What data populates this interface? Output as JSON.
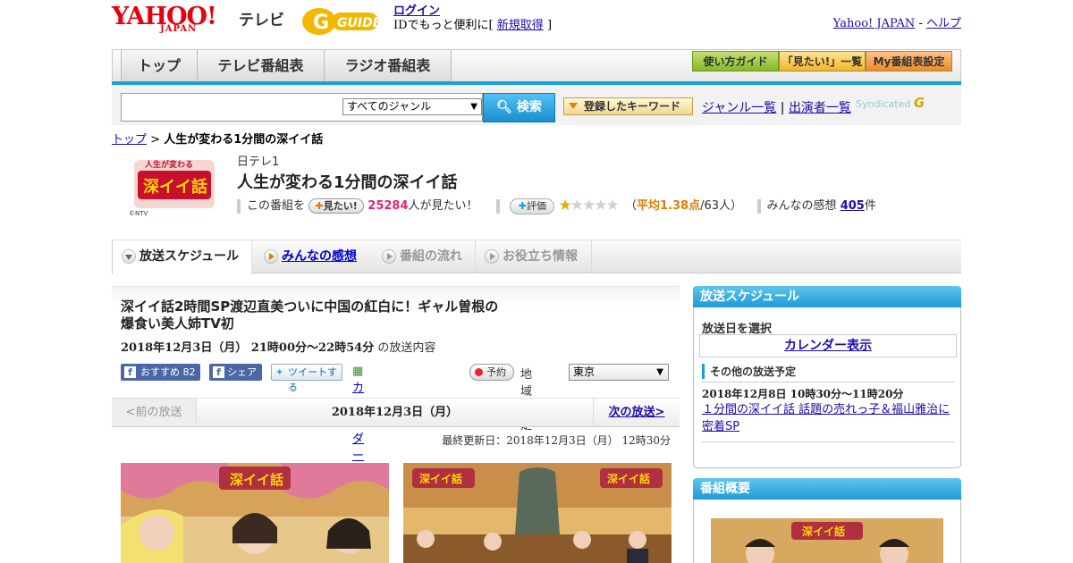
{
  "header": {
    "yahoo_logo": "YAHOO!",
    "yahoo_sub": "JAPAN",
    "tv_label": "テレビ",
    "gguide_logo": "G GUIDE",
    "login_link": "ログイン",
    "login_prefix": "IDでもっと便利に[",
    "register_link": "新規取得",
    "login_suffix": "]",
    "yahoo_japan_link": "Yahoo! JAPAN",
    "separator": "-",
    "help_link": "ヘルプ"
  },
  "nav": {
    "tabs": [
      "トップ",
      "テレビ番組表",
      "ラジオ番組表"
    ],
    "guide_btn": "使い方ガイド",
    "mitai_list_btn": "「見たい!」一覧",
    "my_table_btn": "My番組表設定"
  },
  "search": {
    "genre_value": "すべてのジャンル",
    "search_btn": "検索",
    "keyword_btn": "登録したキーワード",
    "genre_list_link": "ジャンル一覧",
    "pipe": "|",
    "performer_link": "出演者一覧",
    "syndicated": "Syndicated"
  },
  "breadcrumb": {
    "top": "トップ",
    "sep": ">",
    "current": "人生が変わる1分間の深イイ話"
  },
  "program": {
    "channel": "日テレ1",
    "title": "人生が変わる1分間の深イイ話",
    "logo_text": "人生が変わる1分間の深イイ話",
    "logo_credit": "©NTV",
    "this_program": "この番組を",
    "mitai_btn": "見たい!",
    "mitai_count": "25284",
    "mitai_suffix": "人が見たい！",
    "hyoka_btn": "評価",
    "rating_value": 1.38,
    "rating_open": "（",
    "rating_avg": "平均1.38点",
    "rating_count": "/63人）",
    "impressions_label": "みんなの感想",
    "impressions_count": "405",
    "impressions_suffix": "件"
  },
  "tabs": [
    {
      "label": "放送スケジュール"
    },
    {
      "label": "みんなの感想"
    },
    {
      "label": "番組の流れ"
    },
    {
      "label": "お役立ち情報"
    }
  ],
  "episode": {
    "title_line1": "深イイ話2時間SP渡辺直美ついに中国の紅白に！ギャル曽根の",
    "title_line2": "爆食い美人姉TV初",
    "datetime": "2018年12月3日（月） 21時00分～22時54分",
    "datetime_suffix": " の放送内容",
    "fb_recommend": "おすすめ 82",
    "fb_share": "シェア",
    "tweet": "ツイートする",
    "calendar_register": "カレンダーに登録",
    "reserve": "予約",
    "region_label": "地域設定",
    "region_value": "東京",
    "prev": "<前の放送",
    "current_date": "2018年12月3日（月）",
    "next": "次の放送>",
    "updated": "最終更新日：2018年12月3日（月） 12時30分"
  },
  "sidebar": {
    "schedule_head": "放送スケジュール",
    "pick_date": "放送日を選択",
    "calendar": "カレンダー表示",
    "other_schedule": "その他の放送予定",
    "other_date": "2018年12月8日 10時30分～11時20分",
    "other_link": "１分間の深イイ話 話題の売れっ子＆福山雅治に密着SP",
    "overview_head": "番組概要"
  }
}
